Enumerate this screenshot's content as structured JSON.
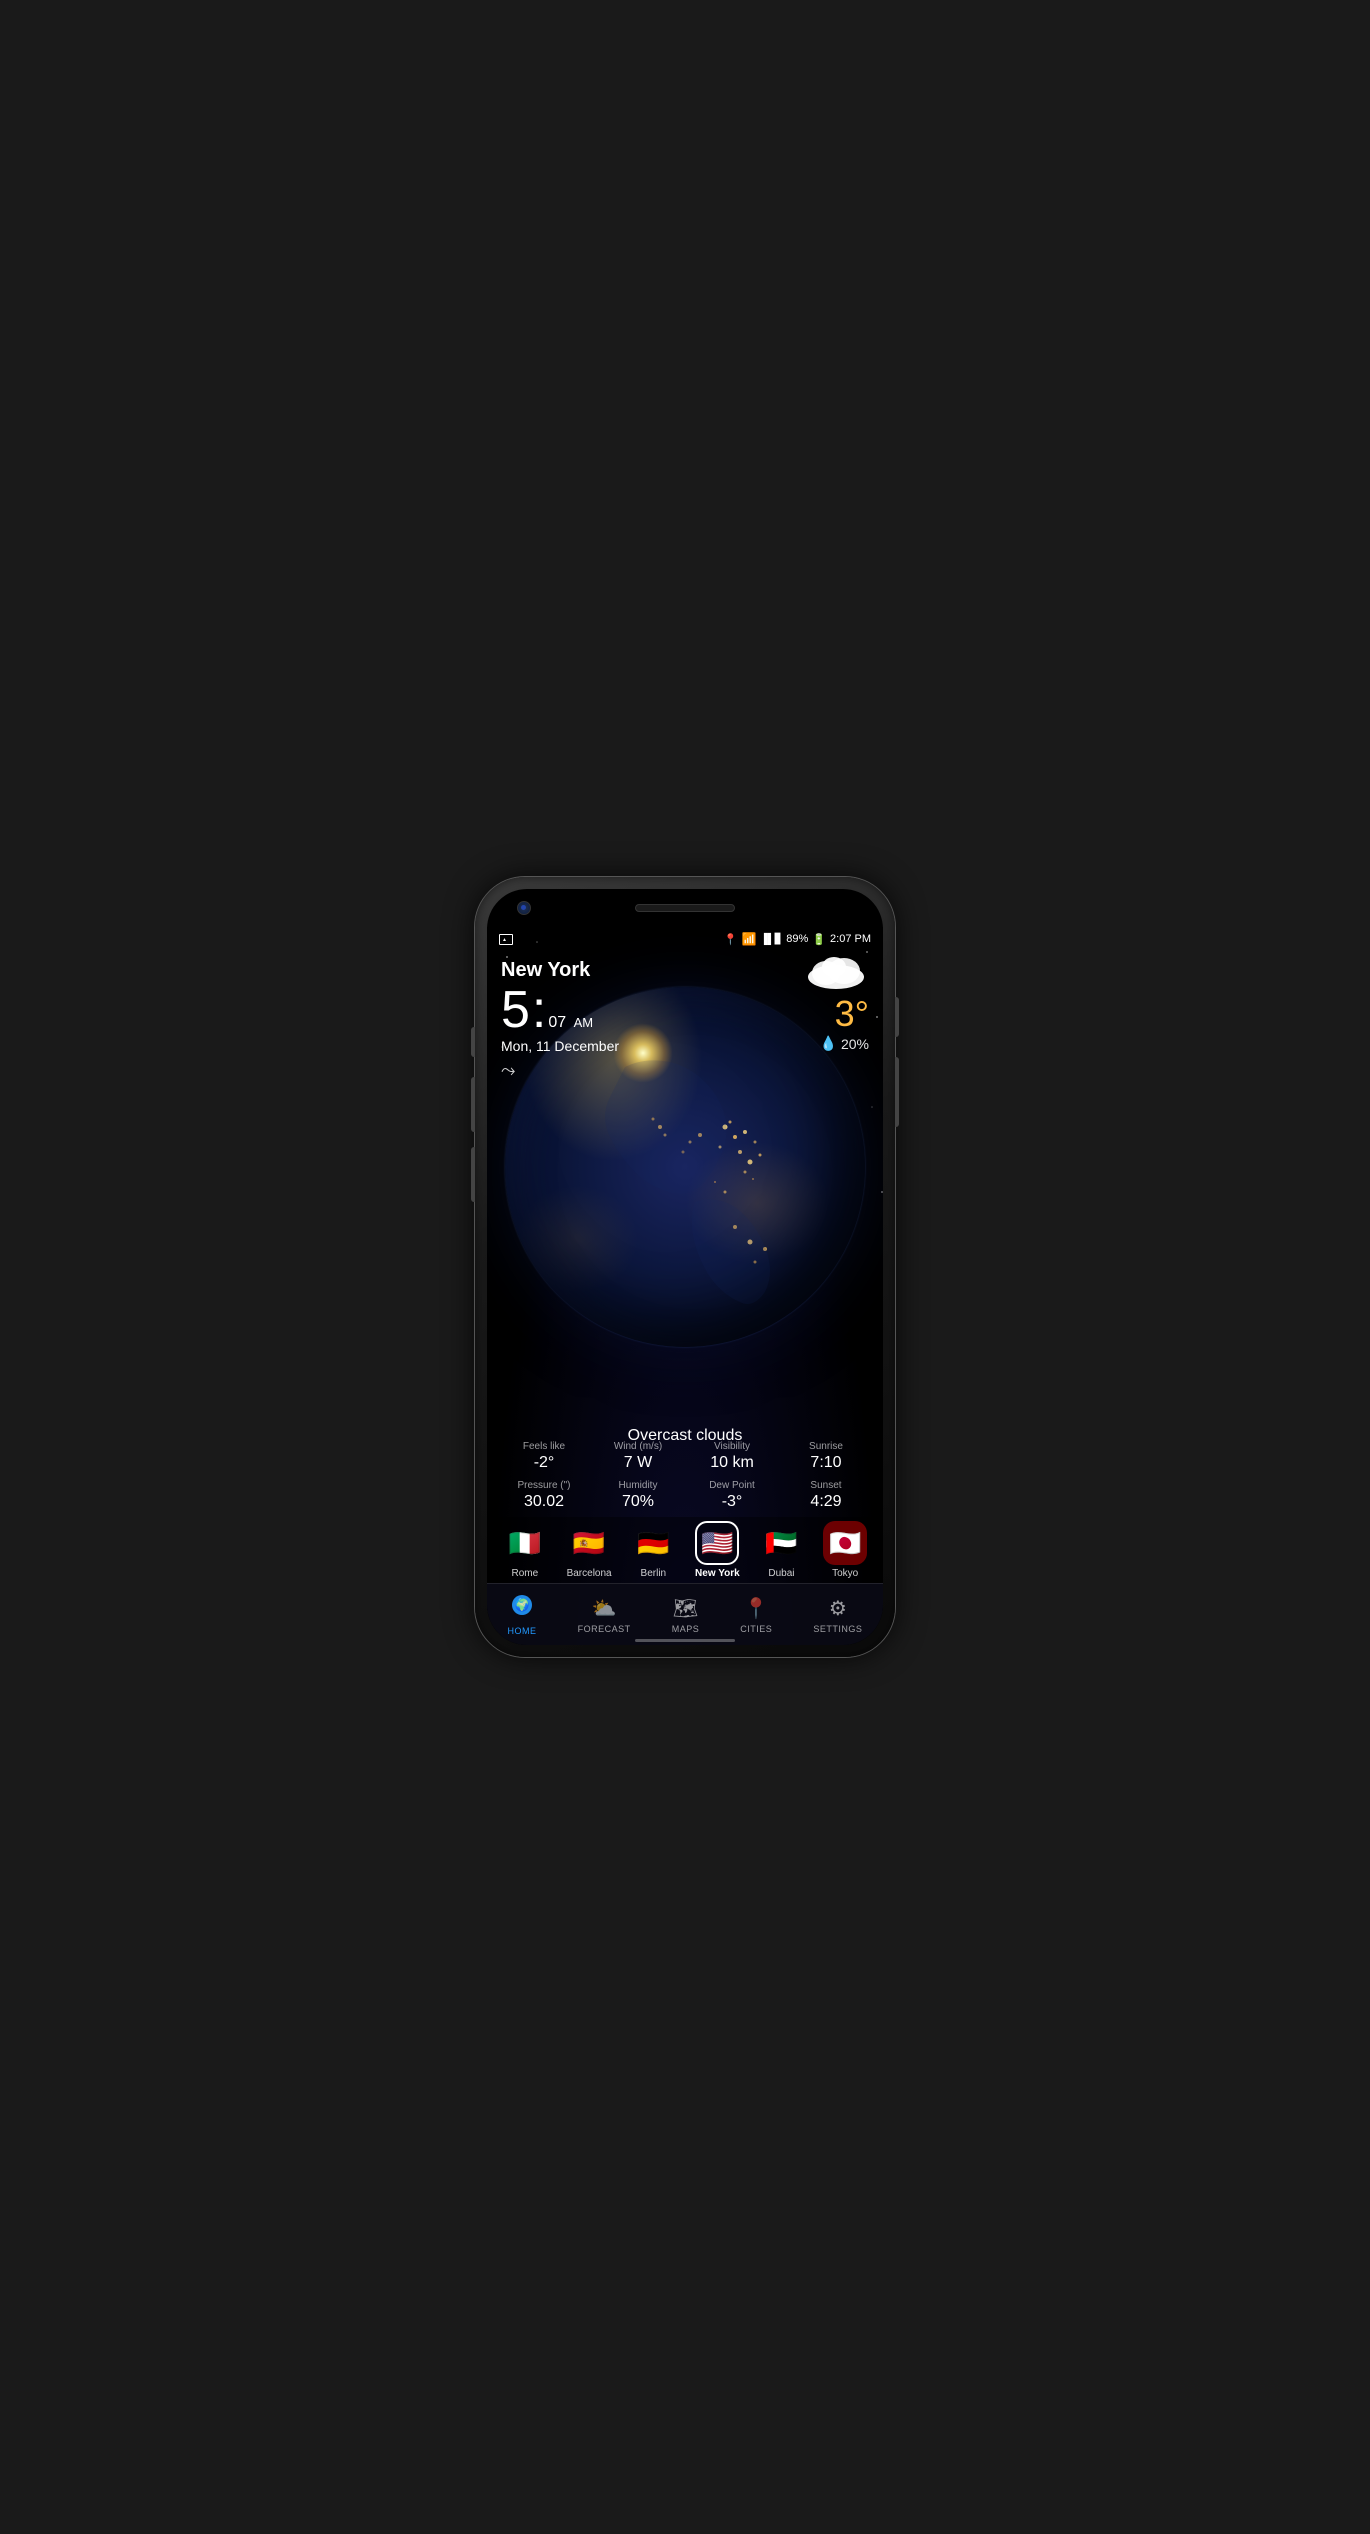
{
  "phone": {
    "status_bar": {
      "battery": "89%",
      "time": "2:07 PM"
    },
    "weather": {
      "city": "New York",
      "time_hour": "5",
      "time_min": "07",
      "time_period": "AM",
      "date": "Mon, 11 December",
      "temperature": "3°",
      "precipitation": "20%",
      "description": "Overcast clouds",
      "feels_like_label": "Feels like",
      "feels_like_value": "-2°",
      "wind_label": "Wind (m/s)",
      "wind_value": "7 W",
      "visibility_label": "Visibility",
      "visibility_value": "10 km",
      "sunrise_label": "Sunrise",
      "sunrise_value": "7:10",
      "pressure_label": "Pressure (\")",
      "pressure_value": "30.02",
      "humidity_label": "Humidity",
      "humidity_value": "70%",
      "dew_point_label": "Dew Point",
      "dew_point_value": "-3°",
      "sunset_label": "Sunset",
      "sunset_value": "4:29"
    },
    "cities": [
      {
        "name": "Rome",
        "flag": "🇮🇹",
        "active": false
      },
      {
        "name": "Barcelona",
        "flag": "🇪🇸",
        "active": false
      },
      {
        "name": "Berlin",
        "flag": "🇩🇪",
        "active": false
      },
      {
        "name": "New York",
        "flag": "🇺🇸",
        "active": true
      },
      {
        "name": "Dubai",
        "flag": "🇦🇪",
        "active": false
      },
      {
        "name": "Tokyo",
        "flag": "🇯🇵",
        "active": false
      }
    ],
    "nav": [
      {
        "id": "home",
        "label": "HOME",
        "active": true
      },
      {
        "id": "forecast",
        "label": "FORECAST",
        "active": false
      },
      {
        "id": "maps",
        "label": "MAPS",
        "active": false
      },
      {
        "id": "cities",
        "label": "CITIES",
        "active": false
      },
      {
        "id": "settings",
        "label": "SETTINGS",
        "active": false
      }
    ]
  }
}
